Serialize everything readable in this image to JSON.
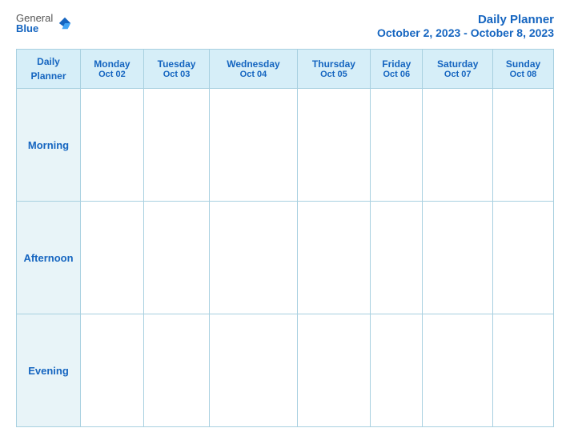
{
  "logo": {
    "general": "General",
    "blue": "Blue"
  },
  "header": {
    "title": "Daily Planner",
    "date_range": "October 2, 2023 - October 8, 2023"
  },
  "table": {
    "label_header_line1": "Daily",
    "label_header_line2": "Planner",
    "days": [
      {
        "name": "Monday",
        "date": "Oct 02"
      },
      {
        "name": "Tuesday",
        "date": "Oct 03"
      },
      {
        "name": "Wednesday",
        "date": "Oct 04"
      },
      {
        "name": "Thursday",
        "date": "Oct 05"
      },
      {
        "name": "Friday",
        "date": "Oct 06"
      },
      {
        "name": "Saturday",
        "date": "Oct 07"
      },
      {
        "name": "Sunday",
        "date": "Oct 08"
      }
    ],
    "time_slots": [
      "Morning",
      "Afternoon",
      "Evening"
    ]
  }
}
